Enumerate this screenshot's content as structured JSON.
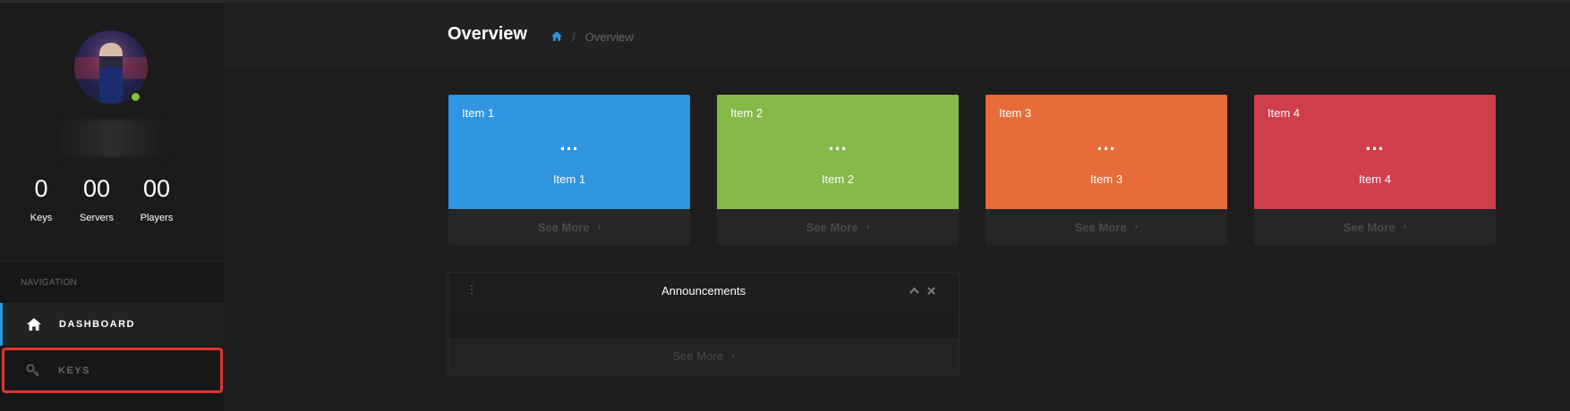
{
  "sidebar": {
    "stats": [
      {
        "value": "0",
        "label": "Keys"
      },
      {
        "value": "00",
        "label": "Servers"
      },
      {
        "value": "00",
        "label": "Players"
      }
    ],
    "nav_heading": "NAVIGATION",
    "nav": [
      {
        "label": "DASHBOARD",
        "icon": "home-icon",
        "active": true
      },
      {
        "label": "KEYS",
        "icon": "key-icon",
        "active": false
      }
    ]
  },
  "header": {
    "title": "Overview",
    "breadcrumb": {
      "home_icon": "home-icon",
      "current": "Overview"
    }
  },
  "cards": [
    {
      "title": "Item 1",
      "value": "...",
      "subtitle": "Item 1",
      "footer": "See More",
      "color": "#2f95e0"
    },
    {
      "title": "Item 2",
      "value": "...",
      "subtitle": "Item 2",
      "footer": "See More",
      "color": "#86b84a"
    },
    {
      "title": "Item 3",
      "value": "...",
      "subtitle": "Item 3",
      "footer": "See More",
      "color": "#e86c3a"
    },
    {
      "title": "Item 4",
      "value": "...",
      "subtitle": "Item 4",
      "footer": "See More",
      "color": "#cf3e4b"
    }
  ],
  "announcements": {
    "title": "Announcements",
    "footer": "See More"
  },
  "colors": {
    "accent": "#2f95e0",
    "highlight_border": "#e0332e",
    "online": "#7ec23a"
  }
}
